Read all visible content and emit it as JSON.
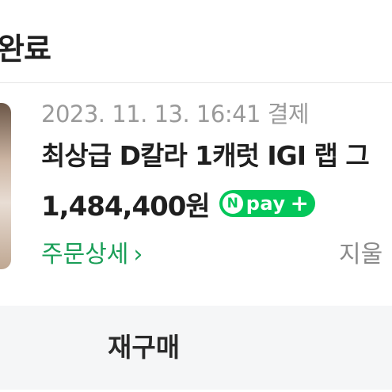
{
  "header": {
    "status_text": "완료"
  },
  "order": {
    "date": "2023. 11. 13. 16:41",
    "payment_label": "결제",
    "product_name": "최상급 D칼라 1캐럿 IGI 랩 그",
    "price": "1,484,400원",
    "npay": {
      "n_letter": "N",
      "text": "pay",
      "plus": "+"
    },
    "detail_link": "주문상세",
    "detail_chevron": "›",
    "delete_link": "지울"
  },
  "actions": {
    "rebuy_label": "재구매"
  },
  "colors": {
    "brand_green": "#03c75a",
    "link_green": "#1a9e57"
  }
}
